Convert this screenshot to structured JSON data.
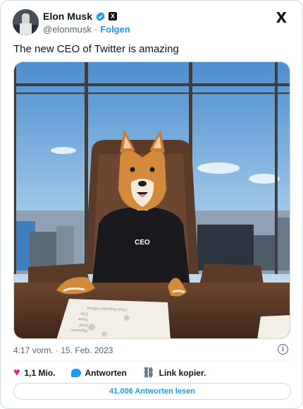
{
  "author": {
    "name": "Elon Musk",
    "handle": "@elonmusk",
    "separator": "·",
    "follow_label": "Folgen",
    "verified_icon": "verified-badge-icon",
    "affiliation_icon": "x-affiliation-icon",
    "affiliation_glyph": "X"
  },
  "platform_logo": "X",
  "tweet": {
    "text": "The new CEO of Twitter is amazing",
    "photo_caption_shirt": "CEO",
    "photo_paper_lines": [
      "Signature:",
      "Field",
      "Name",
      "Title",
      "Chief Executive Officer"
    ],
    "timestamp": "4:17 vorm. · 15. Feb. 2023",
    "info_icon": "info-icon"
  },
  "actions": {
    "likes": "1,1 Mio.",
    "reply_label": "Antworten",
    "copy_link_label": "Link kopier."
  },
  "read_replies_label": "41.006 Antworten lesen",
  "colors": {
    "accent": "#1d9bf0",
    "like": "#f91880",
    "text": "#0f1419",
    "muted": "#536471",
    "border": "#cfd9de"
  }
}
